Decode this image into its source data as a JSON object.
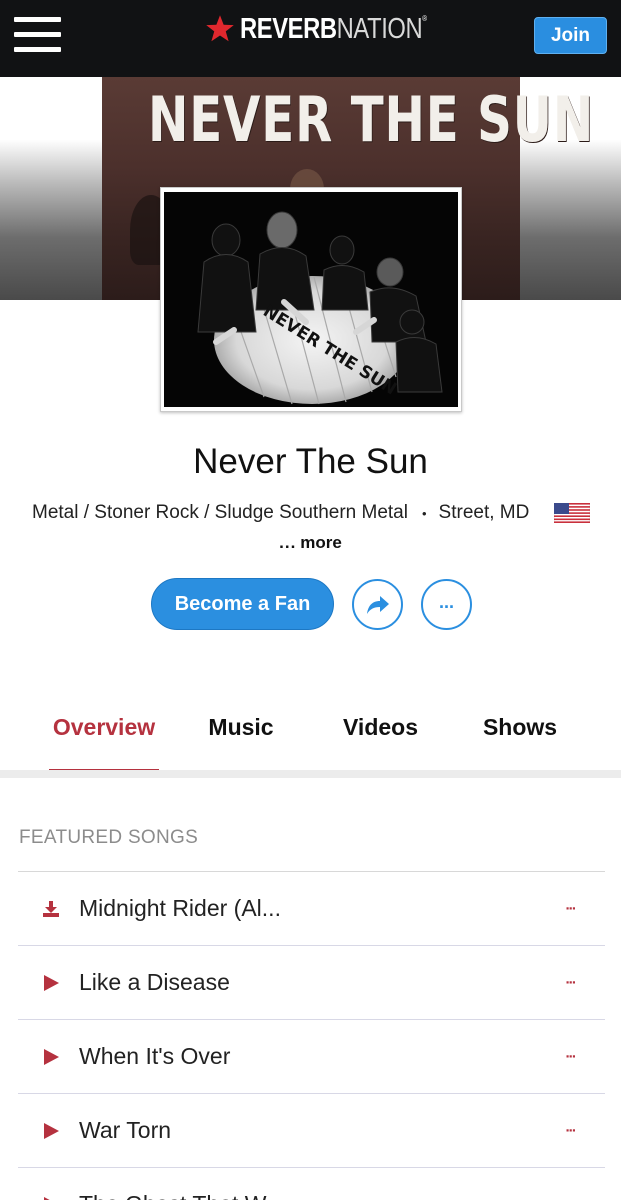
{
  "header": {
    "brand_bold": "REVERB",
    "brand_light": "NATION",
    "brand_mark": "®",
    "join_label": "Join"
  },
  "banner": {
    "title": "NEVER THE SUN",
    "photo_text": "NEVER THE SUN"
  },
  "artist": {
    "name": "Never The Sun",
    "genres": "Metal / Stoner Rock / Sludge Southern Metal",
    "location": "Street, MD",
    "separator": "•",
    "more_dots": "...",
    "more_label": "more"
  },
  "actions": {
    "fan_label": "Become a Fan",
    "options_dots": "..."
  },
  "tabs": [
    {
      "label": "Overview",
      "active": true
    },
    {
      "label": "Music",
      "active": false
    },
    {
      "label": "Videos",
      "active": false
    },
    {
      "label": "Shows",
      "active": false
    }
  ],
  "featured": {
    "heading": "FEATURED SONGS",
    "songs": [
      {
        "title": "Midnight Rider (Al...",
        "icon": "download-icon",
        "more": "..."
      },
      {
        "title": "Like a Disease",
        "icon": "play-icon",
        "more": "..."
      },
      {
        "title": "When It's Over",
        "icon": "play-icon",
        "more": "..."
      },
      {
        "title": "War Torn",
        "icon": "play-icon",
        "more": "..."
      },
      {
        "title": "The Ghost That W...",
        "icon": "play-icon",
        "more": "..."
      }
    ]
  },
  "colors": {
    "topbar": "#111214",
    "accent_blue": "#2b8fe0",
    "accent_red": "#b5323f",
    "logo_star": "#e0282e"
  }
}
